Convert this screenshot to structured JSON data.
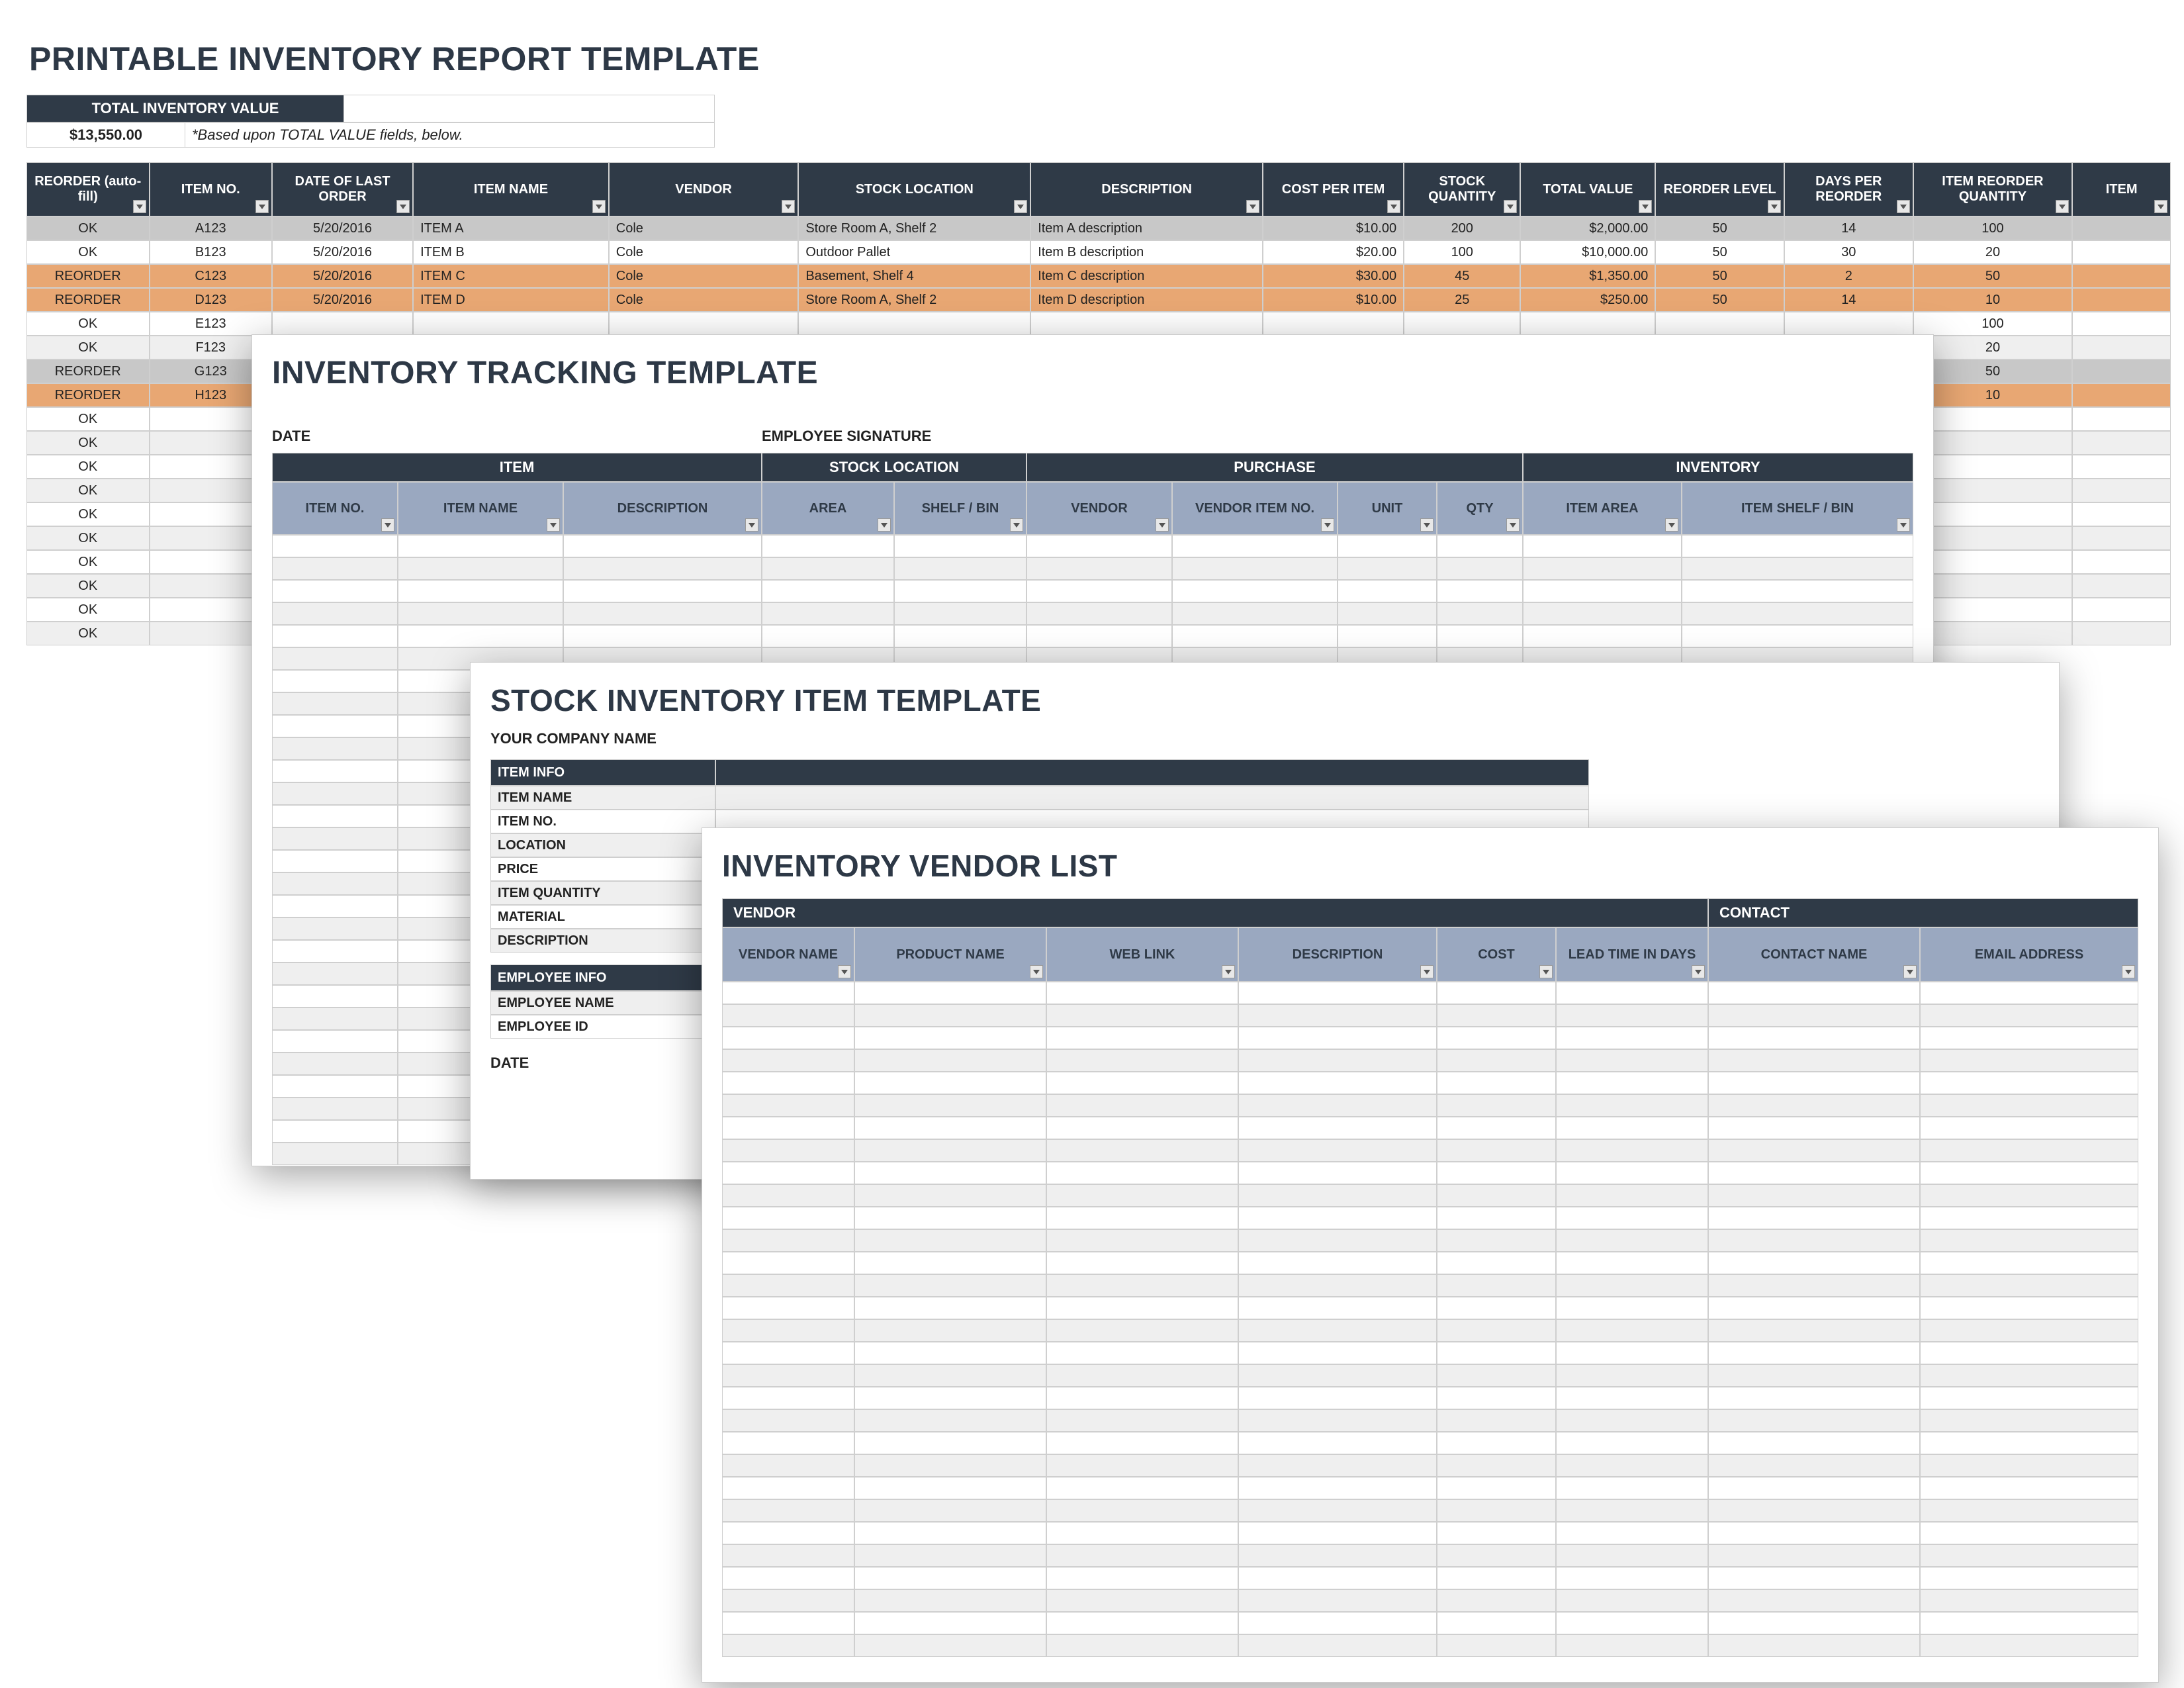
{
  "sheet1": {
    "title": "PRINTABLE INVENTORY REPORT TEMPLATE",
    "total_label": "TOTAL INVENTORY VALUE",
    "total_value": "$13,550.00",
    "total_note": "*Based upon TOTAL VALUE fields, below.",
    "headers": [
      "REORDER (auto-fill)",
      "ITEM NO.",
      "DATE OF LAST ORDER",
      "ITEM NAME",
      "VENDOR",
      "STOCK LOCATION",
      "DESCRIPTION",
      "COST PER ITEM",
      "STOCK QUANTITY",
      "TOTAL VALUE",
      "REORDER LEVEL",
      "DAYS PER REORDER",
      "ITEM REORDER QUANTITY",
      "ITEM"
    ],
    "rows": [
      {
        "r": "OK",
        "no": "A123",
        "d": "5/20/2016",
        "name": "ITEM A",
        "v": "Cole",
        "loc": "Store Room A, Shelf 2",
        "desc": "Item A description",
        "cost": "$10.00",
        "qty": "200",
        "tot": "$2,000.00",
        "rl": "50",
        "dpr": "14",
        "irq": "100",
        "cls": "sel"
      },
      {
        "r": "OK",
        "no": "B123",
        "d": "5/20/2016",
        "name": "ITEM B",
        "v": "Cole",
        "loc": "Outdoor Pallet",
        "desc": "Item B description",
        "cost": "$20.00",
        "qty": "100",
        "tot": "$10,000.00",
        "rl": "50",
        "dpr": "30",
        "irq": "20",
        "cls": ""
      },
      {
        "r": "REORDER",
        "no": "C123",
        "d": "5/20/2016",
        "name": "ITEM C",
        "v": "Cole",
        "loc": "Basement, Shelf 4",
        "desc": "Item C description",
        "cost": "$30.00",
        "qty": "45",
        "tot": "$1,350.00",
        "rl": "50",
        "dpr": "2",
        "irq": "50",
        "cls": "reorder"
      },
      {
        "r": "REORDER",
        "no": "D123",
        "d": "5/20/2016",
        "name": "ITEM D",
        "v": "Cole",
        "loc": "Store Room A, Shelf 2",
        "desc": "Item D description",
        "cost": "$10.00",
        "qty": "25",
        "tot": "$250.00",
        "rl": "50",
        "dpr": "14",
        "irq": "10",
        "cls": "reorder"
      },
      {
        "r": "OK",
        "no": "E123",
        "irq": "100",
        "cls": ""
      },
      {
        "r": "OK",
        "no": "F123",
        "irq": "20",
        "cls": "alt"
      },
      {
        "r": "REORDER",
        "no": "G123",
        "irq": "50",
        "cls": "sel"
      },
      {
        "r": "REORDER",
        "no": "H123",
        "irq": "10",
        "cls": "reorder"
      },
      {
        "r": "OK",
        "cls": ""
      },
      {
        "r": "OK",
        "cls": "alt"
      },
      {
        "r": "OK",
        "cls": ""
      },
      {
        "r": "OK",
        "cls": "alt"
      },
      {
        "r": "OK",
        "cls": ""
      },
      {
        "r": "OK",
        "cls": "alt"
      },
      {
        "r": "OK",
        "cls": ""
      },
      {
        "r": "OK",
        "cls": "alt"
      },
      {
        "r": "OK",
        "cls": ""
      },
      {
        "r": "OK",
        "cls": "alt"
      }
    ]
  },
  "sheet2": {
    "title": "INVENTORY TRACKING TEMPLATE",
    "date_label": "DATE",
    "sig_label": "EMPLOYEE SIGNATURE",
    "groups": [
      "ITEM",
      "STOCK LOCATION",
      "PURCHASE",
      "INVENTORY"
    ],
    "headers": [
      "ITEM NO.",
      "ITEM NAME",
      "DESCRIPTION",
      "AREA",
      "SHELF / BIN",
      "VENDOR",
      "VENDOR ITEM NO.",
      "UNIT",
      "QTY",
      "ITEM AREA",
      "ITEM SHELF / BIN"
    ]
  },
  "sheet3": {
    "title": "STOCK INVENTORY ITEM TEMPLATE",
    "company": "YOUR COMPANY NAME",
    "item_info": "ITEM INFO",
    "item_rows": [
      "ITEM NAME",
      "ITEM NO.",
      "LOCATION",
      "PRICE",
      "ITEM QUANTITY",
      "MATERIAL",
      "DESCRIPTION"
    ],
    "emp_info": "EMPLOYEE INFO",
    "emp_rows": [
      "EMPLOYEE NAME",
      "EMPLOYEE ID"
    ],
    "date_label": "DATE"
  },
  "sheet4": {
    "title": "INVENTORY VENDOR LIST",
    "groups": [
      "VENDOR",
      "CONTACT"
    ],
    "headers": [
      "VENDOR NAME",
      "PRODUCT NAME",
      "WEB LINK",
      "DESCRIPTION",
      "COST",
      "LEAD TIME IN DAYS",
      "CONTACT NAME",
      "EMAIL ADDRESS"
    ]
  }
}
